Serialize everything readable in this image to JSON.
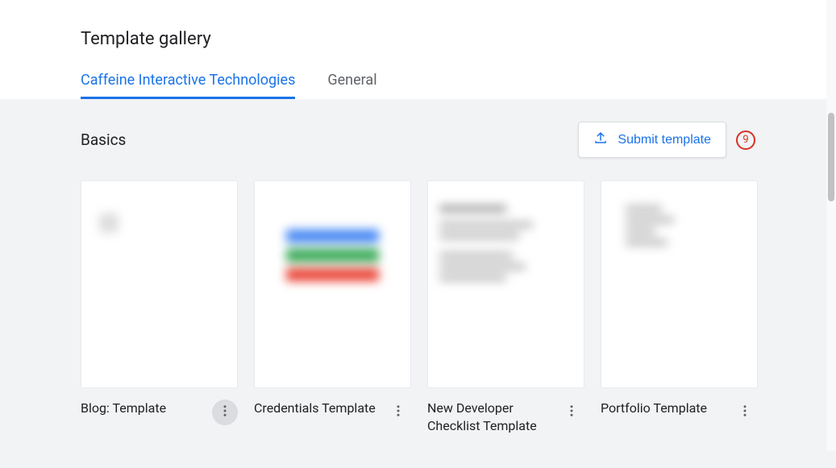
{
  "page_title": "Template gallery",
  "tabs": [
    {
      "label": "Caffeine Interactive Technologies",
      "active": true
    },
    {
      "label": "General",
      "active": false
    }
  ],
  "section": {
    "title": "Basics",
    "submit_label": "Submit template",
    "annotation_number": "9"
  },
  "templates": [
    {
      "name": "Blog: Template",
      "more_highlighted": true
    },
    {
      "name": "Credentials Template",
      "more_highlighted": false
    },
    {
      "name": "New Developer Checklist Template",
      "more_highlighted": false
    },
    {
      "name": "Portfolio Template",
      "more_highlighted": false
    }
  ],
  "colors": {
    "primary": "#1a73e8",
    "danger": "#d93025",
    "bg_gray": "#f1f3f4"
  }
}
